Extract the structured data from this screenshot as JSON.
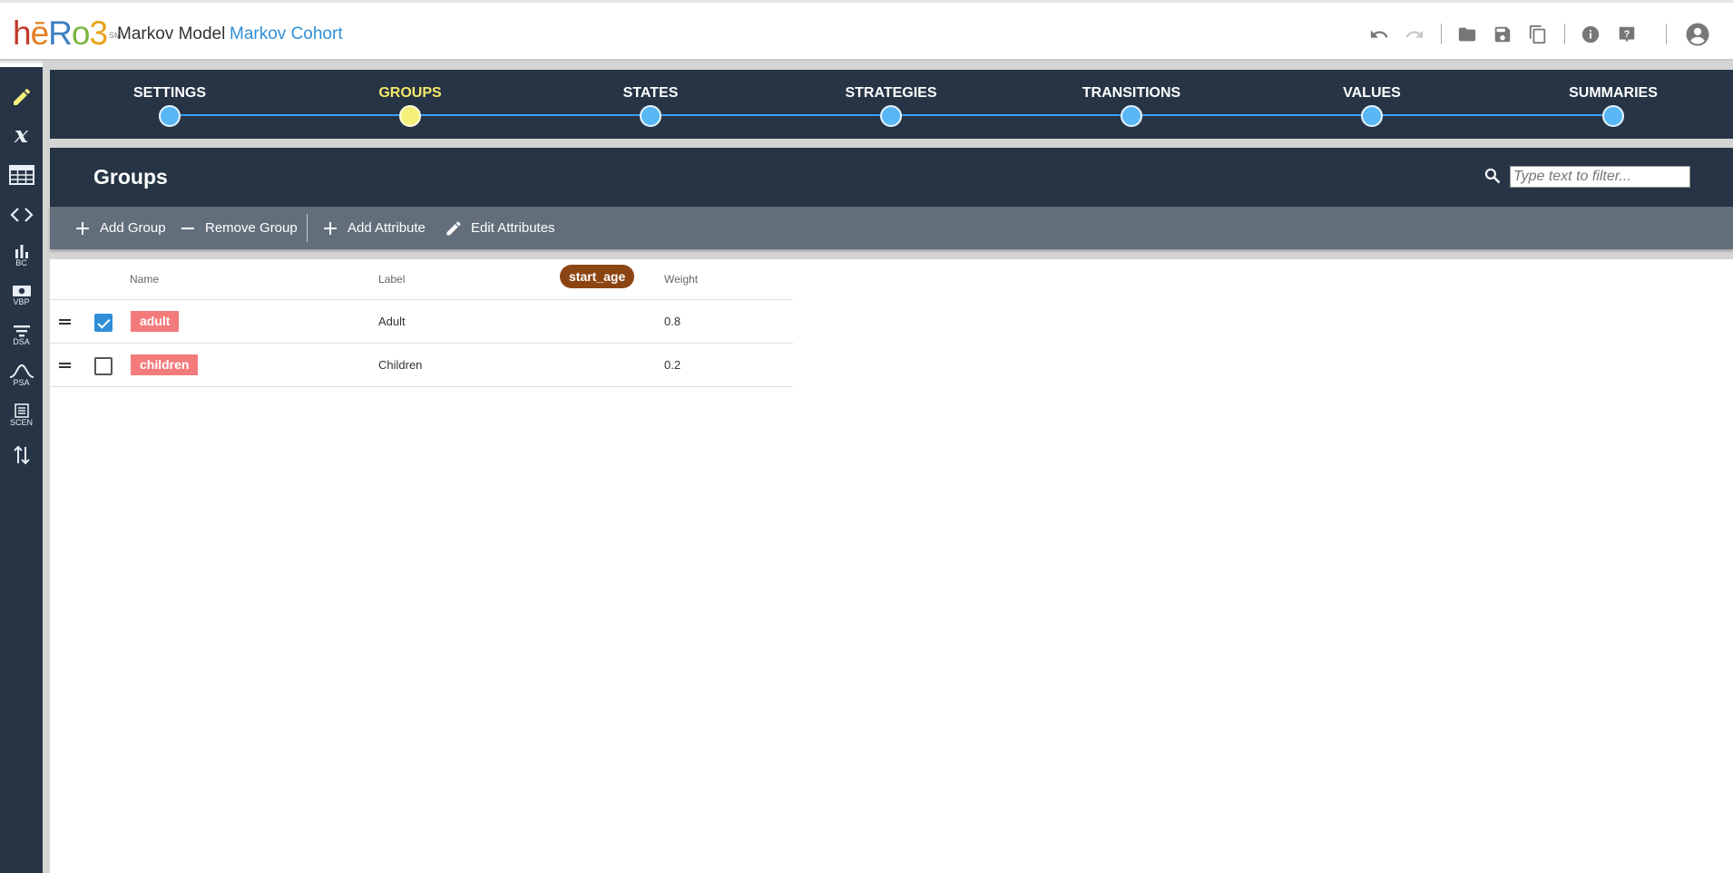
{
  "header": {
    "logo": {
      "h": "h",
      "e": "ē",
      "R": "R",
      "o": "o",
      "t": "3",
      "mark": "SM"
    },
    "model_type": "Markov Model",
    "model_name": "Markov Cohort",
    "icons": [
      "undo-icon",
      "redo-icon",
      "folder-icon",
      "save-icon",
      "copy-icon",
      "info-icon",
      "help-icon",
      "account-icon"
    ]
  },
  "sidebar": {
    "items": [
      {
        "icon": "pencil-icon",
        "label": ""
      },
      {
        "icon": "variable-x-icon",
        "label": ""
      },
      {
        "icon": "table-icon",
        "label": ""
      },
      {
        "icon": "code-icon",
        "label": ""
      },
      {
        "icon": "bar-chart-icon",
        "label": "BC"
      },
      {
        "icon": "money-icon",
        "label": "VBP"
      },
      {
        "icon": "tornado-icon",
        "label": "DSA"
      },
      {
        "icon": "bell-curve-icon",
        "label": "PSA"
      },
      {
        "icon": "list-icon",
        "label": "SCEN"
      },
      {
        "icon": "sort-arrows-icon",
        "label": ""
      }
    ],
    "active_color": "#f5f07a"
  },
  "stepper": {
    "steps": [
      {
        "label": "SETTINGS"
      },
      {
        "label": "GROUPS"
      },
      {
        "label": "STATES"
      },
      {
        "label": "STRATEGIES"
      },
      {
        "label": "TRANSITIONS"
      },
      {
        "label": "VALUES"
      },
      {
        "label": "SUMMARIES"
      }
    ],
    "active": "GROUPS"
  },
  "panel": {
    "title": "Groups",
    "filter_placeholder": "Type text to filter..."
  },
  "toolbar": {
    "add_group": "Add Group",
    "remove_group": "Remove Group",
    "add_attribute": "Add Attribute",
    "edit_attributes": "Edit Attributes"
  },
  "table": {
    "columns": {
      "name": "Name",
      "label": "Label",
      "attribute": "start_age",
      "weight": "Weight"
    },
    "rows": [
      {
        "name": "adult",
        "label": "Adult",
        "start_age": "",
        "weight": "0.8",
        "checked": true
      },
      {
        "name": "children",
        "label": "Children",
        "start_age": "",
        "weight": "0.2",
        "checked": false
      }
    ]
  },
  "colors": {
    "dark": "#263445",
    "toolbar": "#636e7b",
    "accent": "#2e8fd8",
    "tag": "#f47b7b",
    "attribute_pill": "#8b4513"
  }
}
